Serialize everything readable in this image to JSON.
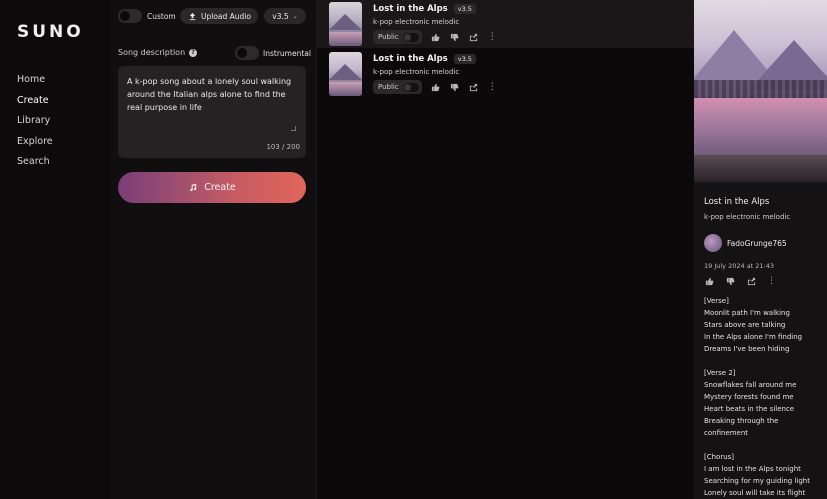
{
  "app": {
    "logo": "SUNO"
  },
  "nav": {
    "items": [
      {
        "label": "Home",
        "active": false
      },
      {
        "label": "Create",
        "active": true
      },
      {
        "label": "Library",
        "active": false
      },
      {
        "label": "Explore",
        "active": false
      },
      {
        "label": "Search",
        "active": false
      }
    ]
  },
  "create": {
    "custom_label": "Custom",
    "upload_label": "Upload Audio",
    "version_label": "v3.5",
    "description_label": "Song description",
    "instrumental_label": "Instrumental",
    "description_value": "A k-pop song about a lonely soul walking around the Italian alps alone to find the real purpose in life",
    "char_counter": "103 / 200",
    "create_label": "Create"
  },
  "songs": [
    {
      "title": "Lost in the Alps",
      "version": "v3.5",
      "style": "k-pop electronic melodic",
      "visibility": "Public"
    },
    {
      "title": "Lost in the Alps",
      "version": "v3.5",
      "style": "k-pop electronic melodic",
      "visibility": "Public"
    }
  ],
  "detail": {
    "title": "Lost in the Alps",
    "style": "k-pop electronic melodic",
    "author": "FadoGrunge765",
    "date": "19 July 2024 at 21:43",
    "lyrics": [
      "[Verse]",
      "Moonlit path I'm walking",
      "Stars above are talking",
      "In the Alps alone I'm finding",
      "Dreams I've been hiding",
      "",
      "[Verse 2]",
      "Snowflakes fall around me",
      "Mystery forests found me",
      "Heart beats in the silence",
      "Breaking through the",
      "confinement",
      "",
      "[Chorus]",
      "I am lost in the Alps tonight",
      "Searching for my guiding light",
      "Lonely soul will take its flight"
    ]
  },
  "colors": {
    "accent_gradient_start": "#7a3e78",
    "accent_gradient_end": "#e0665a",
    "background": "#0c0a0b"
  }
}
